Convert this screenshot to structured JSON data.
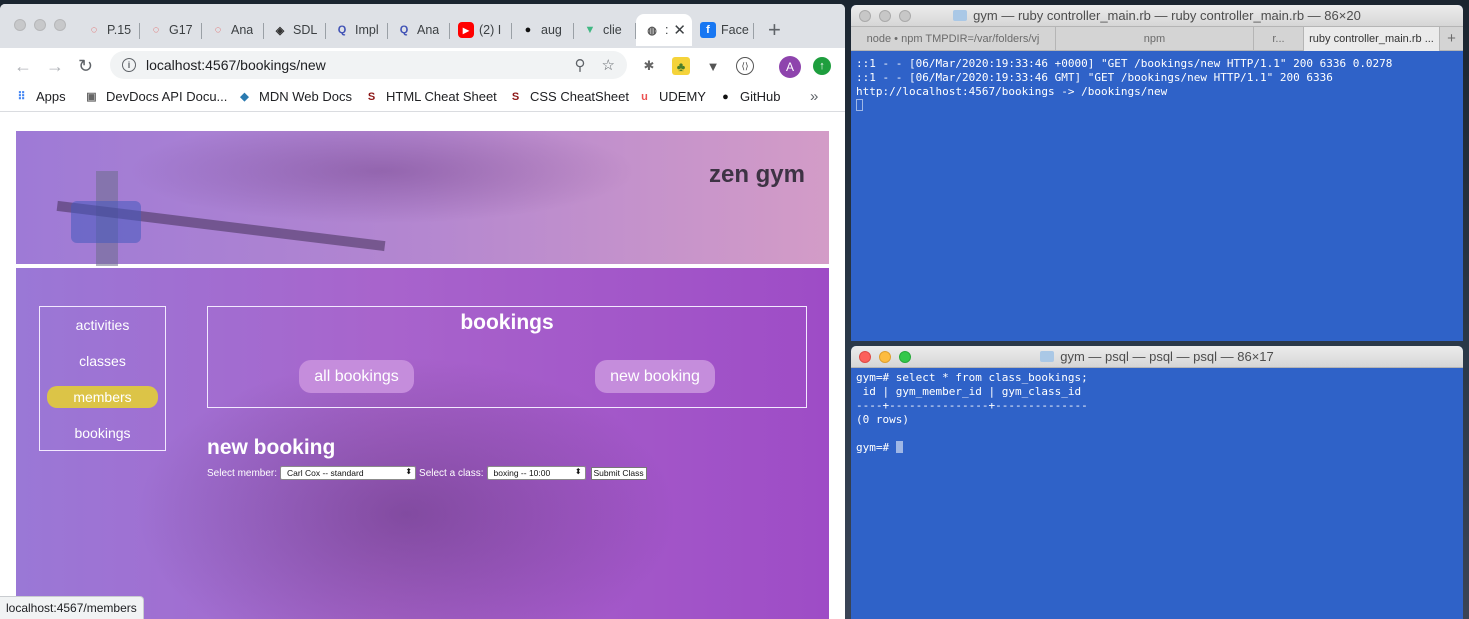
{
  "browser": {
    "tabs": [
      {
        "label": "P.15",
        "icon": "circle-dashed-icon",
        "color": "#e53935"
      },
      {
        "label": "G17",
        "icon": "circle-dashed-icon",
        "color": "#e53935"
      },
      {
        "label": "Ana",
        "icon": "circle-dashed-icon",
        "color": "#e53935"
      },
      {
        "label": "SDL",
        "icon": "diamond-icon",
        "color": "#333333"
      },
      {
        "label": "Impl",
        "icon": "q-icon",
        "color": "#3f51b5"
      },
      {
        "label": "Ana",
        "icon": "q-icon",
        "color": "#3f51b5"
      },
      {
        "label": "(2) I",
        "icon": "youtube-icon",
        "color": "#ff0000"
      },
      {
        "label": "aug",
        "icon": "github-icon",
        "color": "#111111"
      },
      {
        "label": "clie",
        "icon": "vue-icon",
        "color": "#41b883"
      },
      {
        "label": ":",
        "icon": "globe-icon",
        "color": "#555555"
      },
      {
        "label": "Face",
        "icon": "facebook-icon",
        "color": "#1877f2"
      }
    ],
    "new_tab": "+",
    "close_tab": "✕",
    "url": "localhost:4567/bookings/new",
    "profile_initial": "A",
    "bookmarks": [
      {
        "label": "Apps",
        "icon": "apps-grid-icon"
      },
      {
        "label": "DevDocs API Docu...",
        "icon": "devdocs-icon"
      },
      {
        "label": "MDN Web Docs",
        "icon": "mdn-icon"
      },
      {
        "label": "HTML Cheat Sheet",
        "icon": "stanford-icon"
      },
      {
        "label": "CSS CheatSheet",
        "icon": "stanford-icon"
      },
      {
        "label": "UDEMY",
        "icon": "udemy-icon"
      },
      {
        "label": "GitHub",
        "icon": "github-icon"
      }
    ],
    "bookmarks_more": "»",
    "status_url": "localhost:4567/members"
  },
  "site": {
    "title": "zen gym",
    "nav": [
      {
        "label": "activities",
        "active": false
      },
      {
        "label": "classes",
        "active": false
      },
      {
        "label": "members",
        "active": true
      },
      {
        "label": "bookings",
        "active": false
      }
    ],
    "bookings_heading": "bookings",
    "buttons": {
      "all": "all bookings",
      "new": "new booking"
    },
    "form": {
      "heading": "new booking",
      "member_label": "Select member:",
      "member_value": "Carl Cox -- standard",
      "class_label": "Select a class:",
      "class_value": "boxing -- 10:00",
      "submit": "Submit Class"
    },
    "accent_color": "#dcc447"
  },
  "terminal_top": {
    "title": "gym — ruby controller_main.rb — ruby controller_main.rb — 86×20",
    "tabs": [
      "node • npm TMPDIR=/var/folders/vj",
      "npm",
      "r...",
      "ruby controller_main.rb"
    ],
    "new_tab": "+",
    "more": "...",
    "lines": [
      "::1 - - [06/Mar/2020:19:33:46 +0000] \"GET /bookings/new HTTP/1.1\" 200 6336 0.0278",
      "::1 - - [06/Mar/2020:19:33:46 GMT] \"GET /bookings/new HTTP/1.1\" 200 6336",
      "http://localhost:4567/bookings -> /bookings/new"
    ]
  },
  "terminal_bottom": {
    "title": "gym — psql — psql — psql — 86×17",
    "lines": [
      "gym=# select * from class_bookings;",
      " id | gym_member_id | gym_class_id",
      "----+---------------+--------------",
      "(0 rows)",
      "",
      "gym=# "
    ]
  }
}
